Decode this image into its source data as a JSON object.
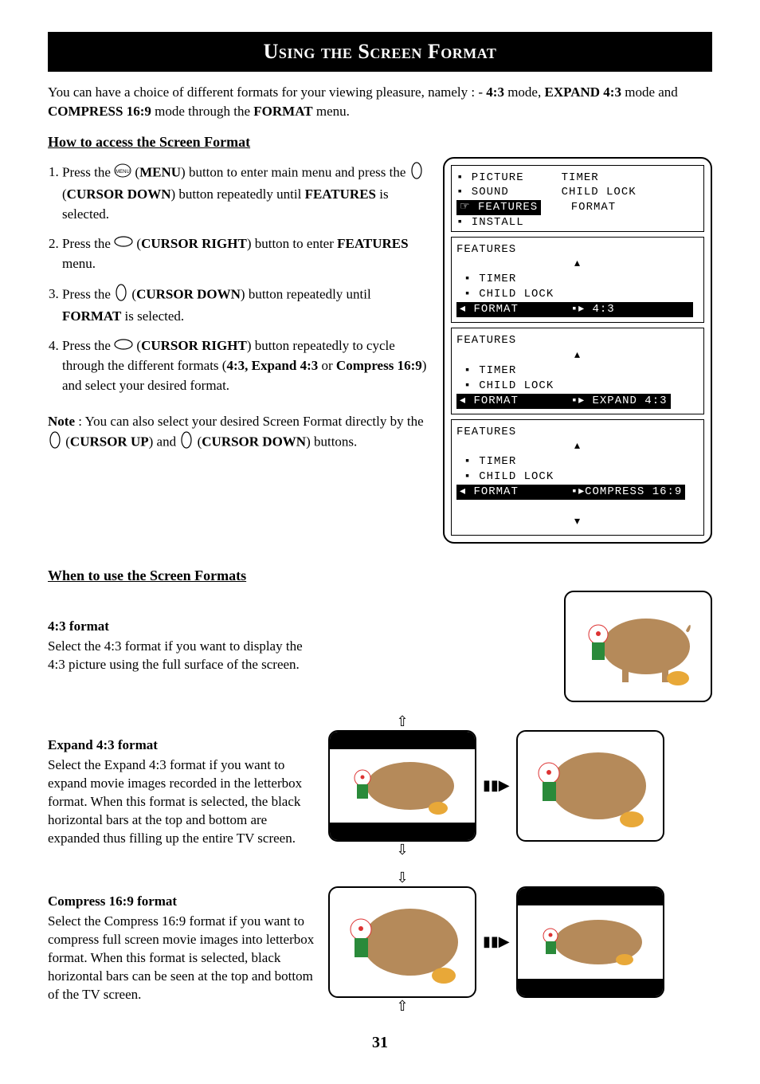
{
  "title": "Using the Screen Format",
  "intro_parts": {
    "p1": "You can have a choice of different formats for your viewing pleasure, namely : - ",
    "b1": "4:3",
    "p2": " mode, ",
    "b2": "EXPAND 4:3",
    "p3": " mode and ",
    "b3": "COMPRESS 16:9",
    "p4": " mode through the ",
    "b4": "FORMAT",
    "p5": " menu."
  },
  "access_head": "How to access the Screen Format",
  "steps": [
    {
      "pre": "Press the ",
      "btn1": "MENU",
      "mid1": ") button to enter main menu and press the ",
      "btn2": "CURSOR DOWN",
      "mid2": ") button repeatedly until ",
      "bold2": "FEATURES",
      "end": " is selected."
    },
    {
      "pre": "Press the ",
      "btn1": "CURSOR RIGHT",
      "mid1": ") button to enter ",
      "bold1": "FEATURES",
      "end": " menu."
    },
    {
      "pre": "Press the ",
      "btn1": "CURSOR DOWN",
      "mid1": ") button repeatedly until ",
      "bold1": "FORMAT",
      "end": " is selected."
    },
    {
      "pre": "Press the ",
      "btn1": "CURSOR RIGHT",
      "mid1": ") button repeatedly to cycle through the different formats (",
      "bold1": "4:3, Expand 4:3",
      "mid2": " or ",
      "bold2": "Compress 16:9",
      "end": ") and select your desired format."
    }
  ],
  "note": {
    "label": "Note",
    "p1": " : You can also select your desired Screen Format directly by the ",
    "b1": "CURSOR UP",
    "p2": ") and ",
    "b2": "CURSOR DOWN",
    "p3": ") buttons."
  },
  "osd": {
    "main": {
      "picture": "▪ PICTURE",
      "sound": "▪ SOUND",
      "features": "FEATURES",
      "install": "▪ INSTALL",
      "timer": "TIMER",
      "childlock": "CHILD LOCK",
      "format": "FORMAT"
    },
    "sub": {
      "title": "FEATURES",
      "timer": "▪ TIMER",
      "childlock": "▪ CHILD LOCK",
      "format": "FORMAT",
      "v1": "4:3",
      "v2": "EXPAND 4:3",
      "v3": "COMPRESS 16:9"
    }
  },
  "when_head": "When to use the Screen Formats",
  "formats": {
    "f43_head": "4:3 format",
    "f43_body": "Select the 4:3 format if you want to display the 4:3 picture using the full surface of the screen.",
    "exp_head": "Expand 4:3 format",
    "exp_body": "Select the Expand 4:3 format if you want to expand movie images recorded in the letterbox format.  When this format is selected, the black horizontal bars at the top and bottom are expanded thus filling up the entire TV screen.",
    "comp_head": "Compress 16:9 format",
    "comp_body": "Select the Compress 16:9 format if you want to compress full screen movie images into letterbox format. When this format is selected, black horizontal bars can be seen at the top and bottom of the TV screen."
  },
  "page_number": "31"
}
